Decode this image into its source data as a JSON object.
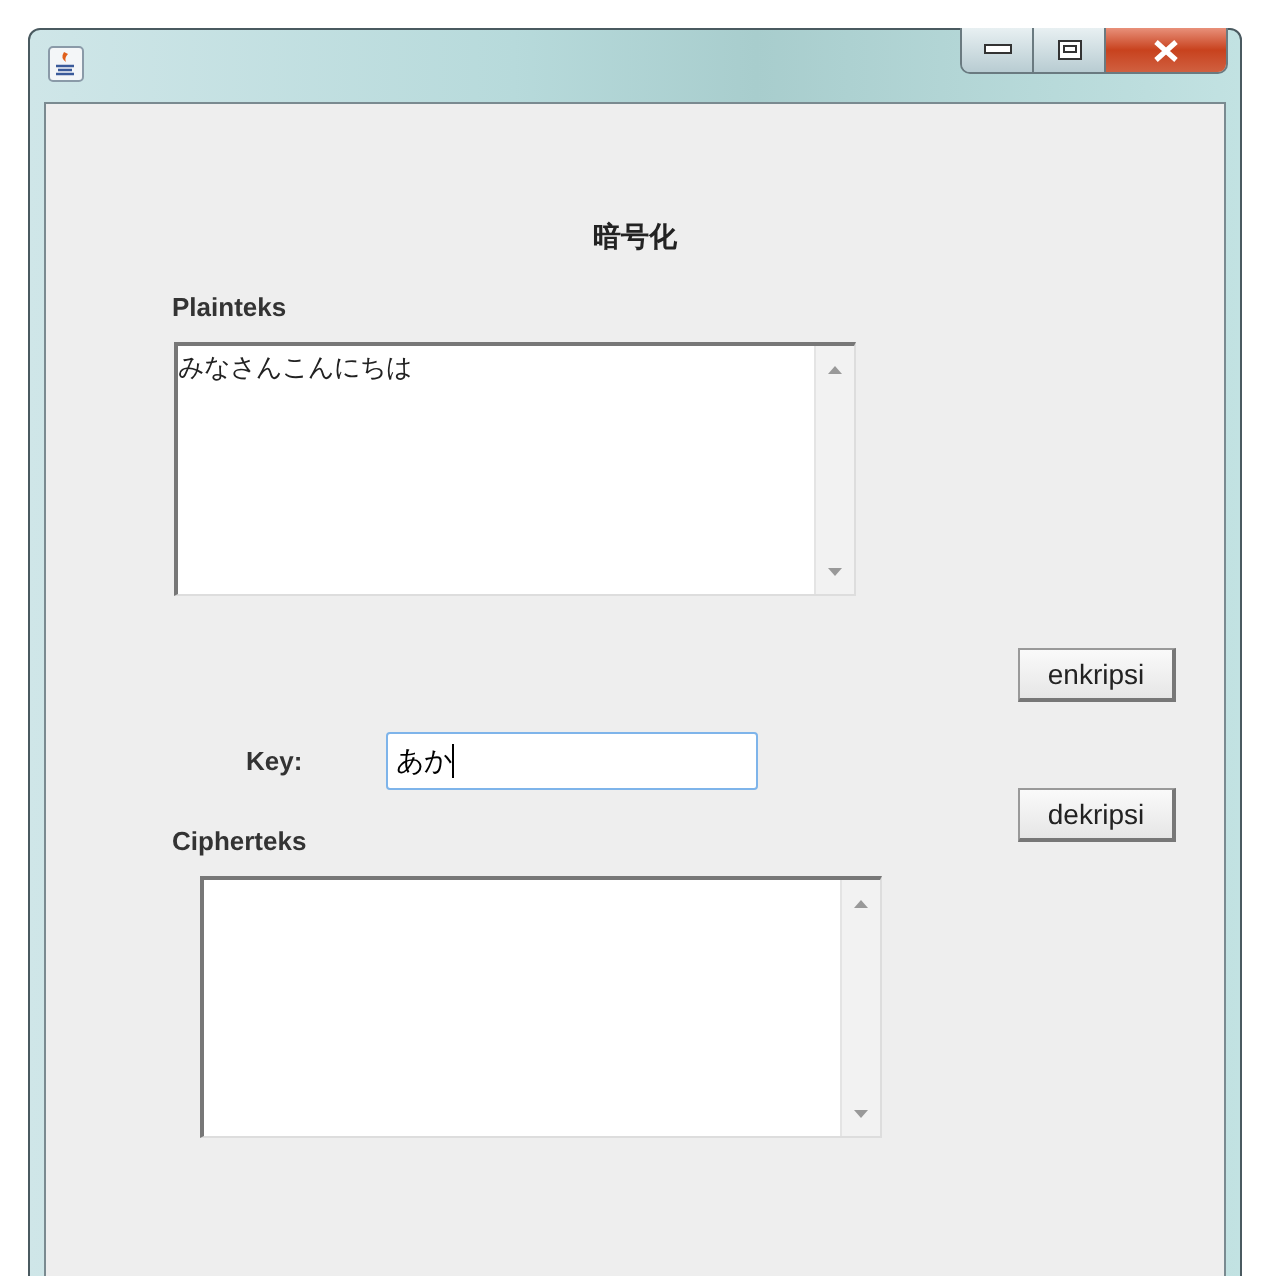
{
  "heading": "暗号化",
  "plaintext": {
    "label": "Plainteks",
    "value": "みなさんこんにちは"
  },
  "key": {
    "label": "Key:",
    "value": "あか"
  },
  "buttons": [
    {
      "label": "enkripsi"
    },
    {
      "label": "dekripsi"
    }
  ],
  "ciphertext": {
    "label": "Cipherteks"
  }
}
